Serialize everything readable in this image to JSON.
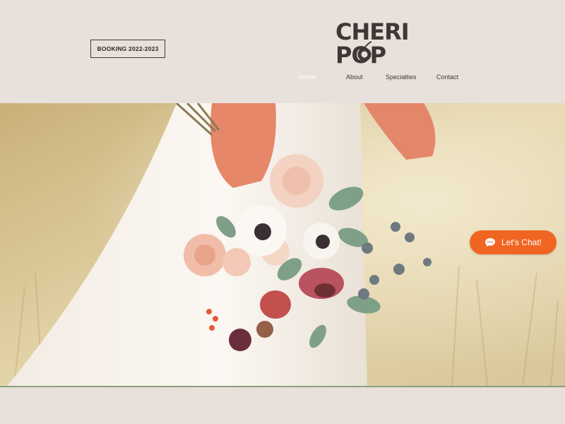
{
  "header": {
    "booking_label": "BOOKING 2022-2023",
    "logo_text_line1": "CHERI",
    "logo_text_line2": "POP"
  },
  "nav": {
    "items": [
      {
        "label": "Home",
        "active": true
      },
      {
        "label": "About",
        "active": false
      },
      {
        "label": "Specialties",
        "active": false
      },
      {
        "label": "Contact",
        "active": false
      }
    ]
  },
  "chat": {
    "label": "Let's Chat!",
    "color": "#f06522"
  },
  "colors": {
    "background": "#e8e0da",
    "text_dark": "#3b3633",
    "logo": "#3e3936",
    "accent_line": "#8aa07e"
  }
}
